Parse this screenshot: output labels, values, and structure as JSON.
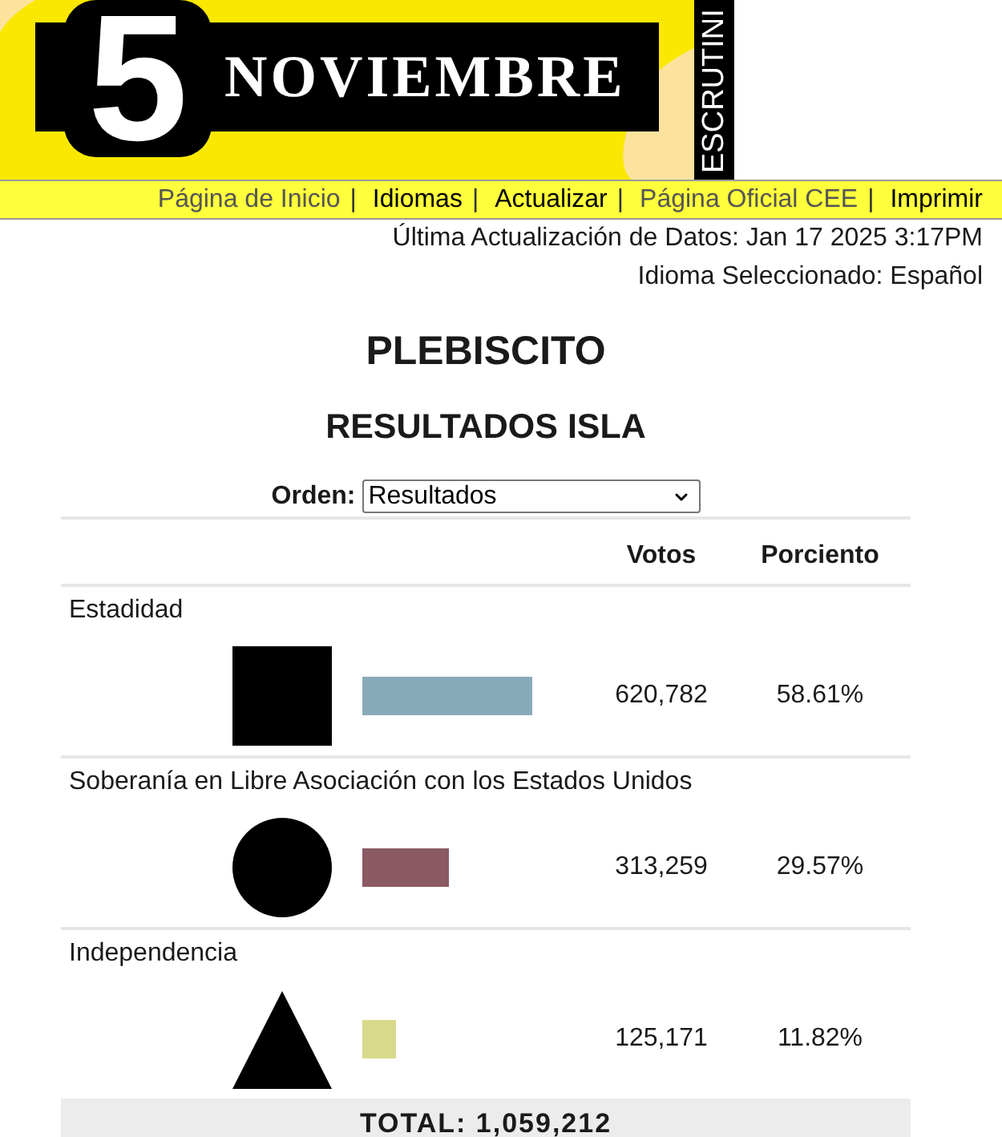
{
  "banner": {
    "number": "5",
    "title": "NOVIEMBRE",
    "side_label": "ESCRUTINI"
  },
  "nav": [
    {
      "kind": "link",
      "label": "Página de Inicio",
      "visited": true
    },
    {
      "kind": "separator",
      "text": "|"
    },
    {
      "kind": "link",
      "label": "Idiomas",
      "visited": false
    },
    {
      "kind": "separator",
      "text": "|"
    },
    {
      "kind": "link",
      "label": "Actualizar",
      "visited": false
    },
    {
      "kind": "separator",
      "text": "|"
    },
    {
      "kind": "link",
      "label": "Página Oficial CEE",
      "visited": true
    },
    {
      "kind": "separator",
      "text": "|"
    },
    {
      "kind": "link",
      "label": "Imprimir",
      "visited": false
    }
  ],
  "last_update": "Última Actualización de Datos: Jan 17 2025 3:17PM",
  "language": "Idioma Seleccionado: Español",
  "title": "PLEBISCITO",
  "subtitle": "RESULTADOS ISLA",
  "order": {
    "label": "Orden:",
    "value": "Resultados"
  },
  "table": {
    "columns": [
      "Votos",
      "Porciento"
    ],
    "rows": [
      {
        "name": "Estadidad",
        "kind": "square",
        "color": "#87aab9",
        "votes": "620,782",
        "percent": "58.61%"
      },
      {
        "name": "Soberanía en Libre Asociación con los Estados Unidos",
        "kind": "circle",
        "color": "#8b5a63",
        "votes": "313,259",
        "percent": "29.57%"
      },
      {
        "name": "Independencia",
        "kind": "triangle",
        "color": "#d8d98a",
        "votes": "125,171",
        "percent": "11.82%"
      }
    ],
    "total": "TOTAL: 1,059,212"
  }
}
